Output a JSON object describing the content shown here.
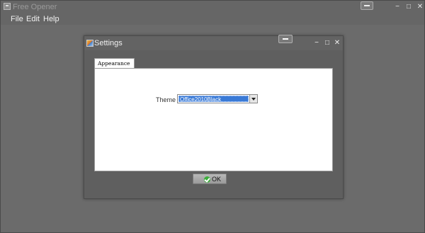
{
  "window": {
    "title": "Free Opener",
    "icon": "app-icon",
    "controls": [
      "help-icon",
      "minimize-icon",
      "maximize-icon",
      "close-icon"
    ]
  },
  "menu": {
    "items": [
      {
        "label": "File"
      },
      {
        "label": "Edit"
      },
      {
        "label": "Help"
      }
    ]
  },
  "dialog": {
    "title": "Settings",
    "icon": "settings-icon",
    "min_glyph": "−",
    "max_glyph": "□",
    "close_glyph": "✕",
    "tabs": [
      {
        "label": "Appearance",
        "selected": true
      }
    ],
    "theme": {
      "label": "Theme",
      "value": "Office2010Black"
    },
    "ok_button": {
      "label": "OK",
      "icon": "check-icon"
    }
  },
  "colors": {
    "selection": "#3a7ad6",
    "ok_icon": "#3cae3c",
    "background": "#6b6b6b"
  }
}
